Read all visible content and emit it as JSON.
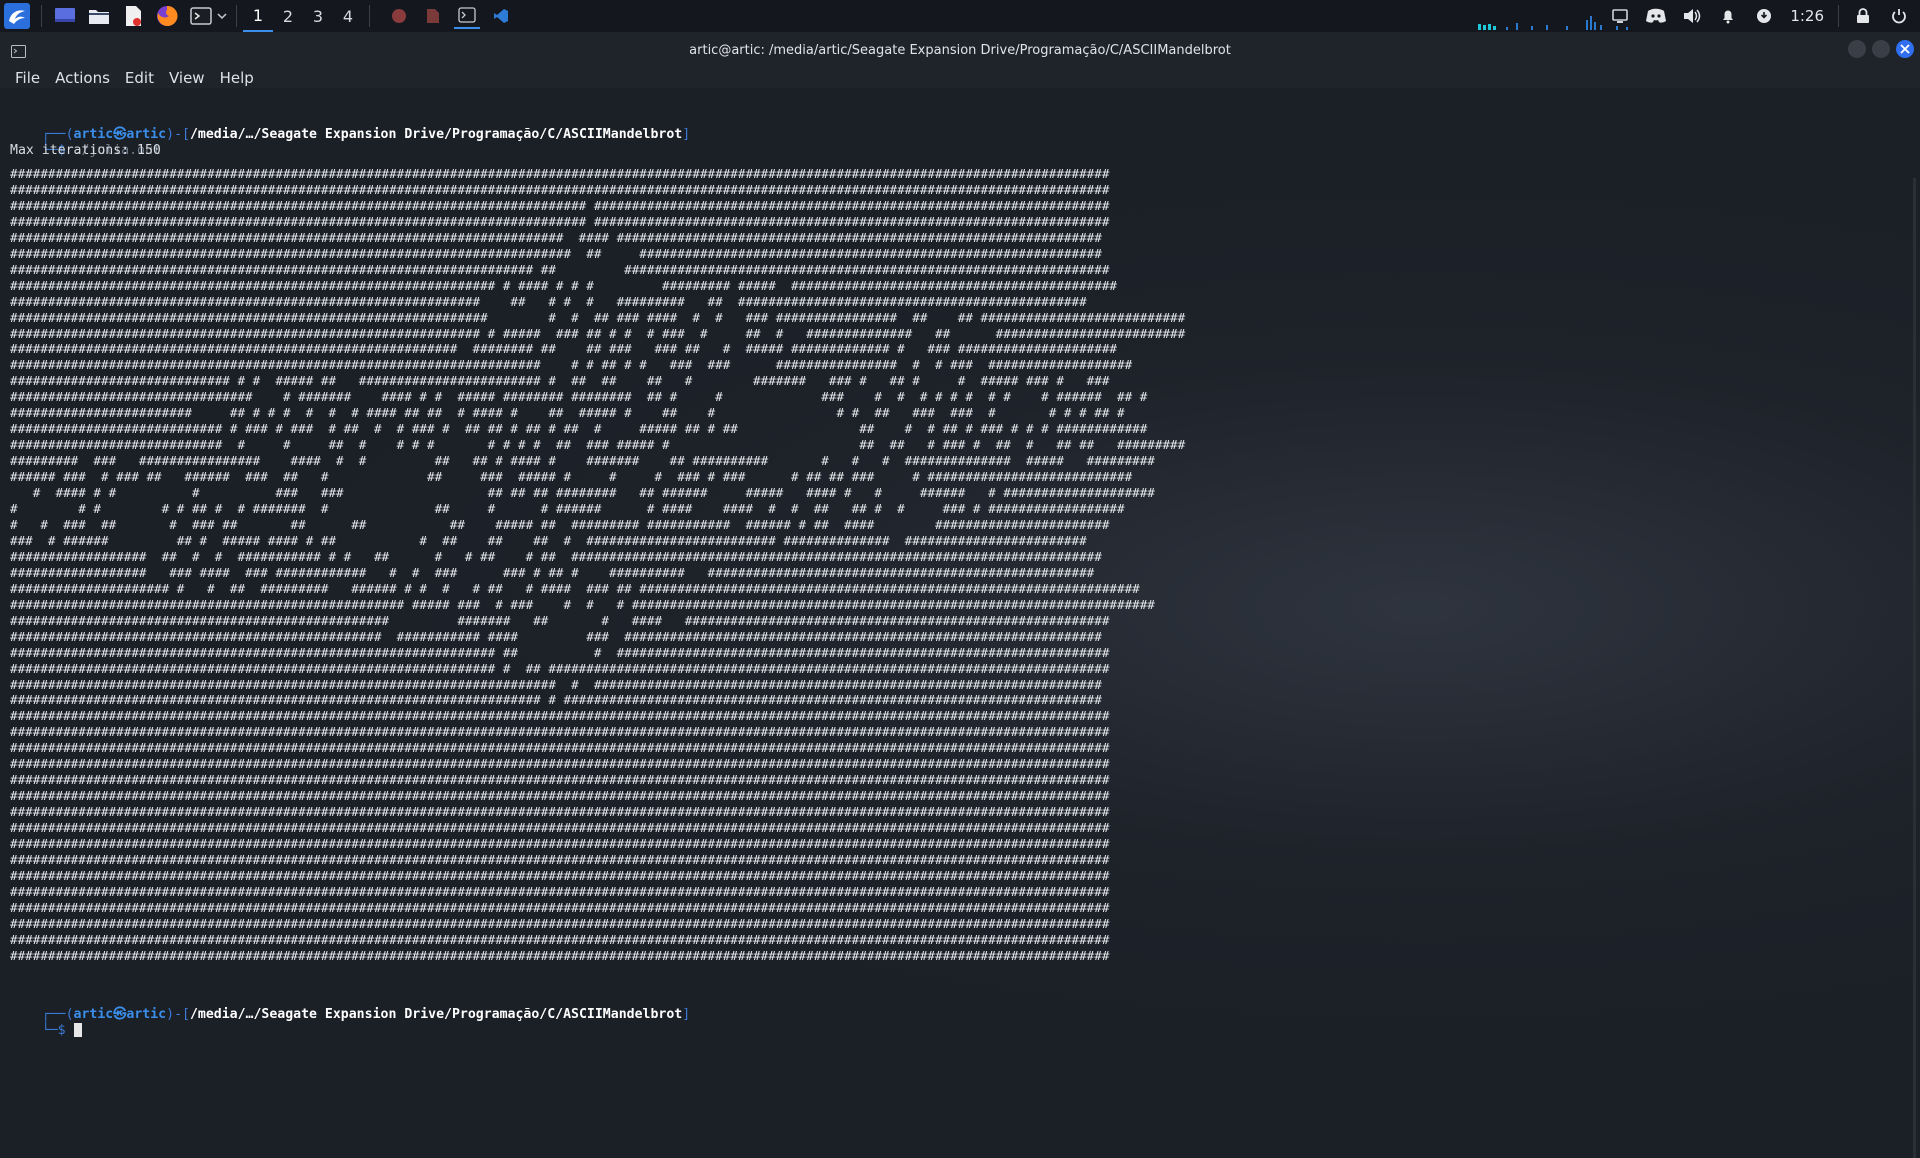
{
  "panel": {
    "workspaces": [
      "1",
      "2",
      "3",
      "4"
    ],
    "active_workspace": 0,
    "clock": "1:26",
    "accent": "#3b8eea"
  },
  "window": {
    "title": "artic@artic: /media/artic/Seagate Expansion Drive/Programação/C/ASCIIMandelbrot"
  },
  "menu": [
    "File",
    "Actions",
    "Edit",
    "View",
    "Help"
  ],
  "terminal": {
    "prompt1": {
      "open": "┌──(",
      "user": "artic㉿artic",
      "mid": ")-[",
      "path": "/media/…/Seagate Expansion Drive/Programação/C/ASCIIMandelbrot",
      "close": "]",
      "line2": "└─$ ",
      "command": "./julia.out"
    },
    "output_header": "Max iterations: 150",
    "ascii_art": [
      "#################################################################################################################################################",
      "#################################################################################################################################################",
      "############################################################################ ####################################################################",
      "############################################################################ ####################################################################",
      "#########################################################################  #### ################################################################",
      "##########################################################################  ##     #############################################################",
      "##################################################################### ##         ################################################################",
      "################################################################ # #### # # #         ######### #####  ###########################################",
      "##############################################################    ##   # #  #   #########   ##  ##############################################",
      "###############################################################        #  #  ## ### ####  #  #   ### ################  ##    ## ###########################",
      "############################################################## # #####  ### ## # #  # ###  #     ##  #   ##############   ##      #########################",
      "###########################################################  ######## ##    ## ###   ### ##   #  ##### ############# #   ### #####################",
      "######################################################################    # # ## # #   ###  ###      ################  #  # ###  ###################",
      "############################# # #  ##### ##   ######################## #  ##  ##    ##   #        #######   ### #   ## #     #  ##### ### #   ###",
      "################################    # #######    #### # #  ##### ######## ########  ## #     #             ###    #  #  # # # #  # #    # ######  ## #",
      "########################     ## # # #  #  #  # #### ## ##  # #### #    ##  ##### #    ##    #                # #  ##   ###  ###  #       # # # ## #",
      "############################ # ### # ###  # ##  #  # ### #  ## ## # ## # ##  #     ##### ## # ##                ##    #  # ## # ### # # # ############",
      "############################  #     #     ##  #    # # #       # # # #  ##  ### ##### #                         ##  ##   # ### #  ##  #   ## ##   #########",
      "#########  ###   ################    ####  #  #         ##   ## # #### #    #######    ## ##########       #   #   #  ##############  #####   #########",
      "###### ###  # ### ##   ######  ###  ##   #             ##     ###  ##### #     #     #  ### # ###      # ## ## ###     # ###########################",
      "   #  #### # #          #          ###   ###                   ## ## ## ########   ## ######     #####   #### #   #     ######   # ####################",
      "#        # #        # # ## #  # #######  #              ##     #      # ######      # ####    ####  #  #  ##   ## #  #     ### # ##################",
      "#   #  ###  ##       #  ### ##       ##      ##           ##    ##### ##  ######### ###########  ###### # ##  ####        #######################",
      "###  # ######         ## #  ##### #### # ##           #  ##    ##    ##  #  ######################### ##############  ########################",
      "##################  ##  #  #  ########### # #   ##      #   # ##    # ##  ######################################################################",
      "##################   ### ####  ### ############   #  #  ###      ### # ## #    ##########   ###################################################",
      "##################### #   #  ##  #########   ###### # #  #   # ##   # ####  ### ## ##################################################################",
      "#################################################### ##### ###  # ###    #  #   # #####################################################################",
      "##################################################         #######   ##       #   ####   ########################################################",
      "#################################################  ########### ####         ###  ###############################################################",
      "################################################################ ##          #  #################################################################",
      "################################################################ #  ## ##########################################################################",
      "########################################################################  #  ###################################################################",
      "###################################################################### # #######################################################################",
      "#################################################################################################################################################",
      "#################################################################################################################################################",
      "#################################################################################################################################################",
      "#################################################################################################################################################",
      "#################################################################################################################################################",
      "#################################################################################################################################################",
      "#################################################################################################################################################",
      "#################################################################################################################################################",
      "#################################################################################################################################################",
      "#################################################################################################################################################",
      "#################################################################################################################################################",
      "#################################################################################################################################################",
      "#################################################################################################################################################",
      "#################################################################################################################################################",
      "#################################################################################################################################################",
      "#################################################################################################################################################"
    ],
    "prompt2": {
      "open": "┌──(",
      "user": "artic㉿artic",
      "mid": ")-[",
      "path": "/media/…/Seagate Expansion Drive/Programação/C/ASCIIMandelbrot",
      "close": "]",
      "line2": "└─$ "
    }
  },
  "icons": {
    "launcher": "kali-dragon-icon",
    "apps": [
      "desktop-icon",
      "file-manager-icon",
      "text-editor-icon",
      "firefox-icon",
      "terminal-icon"
    ],
    "tray": [
      "display-icon",
      "discord-icon",
      "volume-icon",
      "bell-icon",
      "update-icon",
      "lock-icon",
      "power-icon"
    ]
  }
}
